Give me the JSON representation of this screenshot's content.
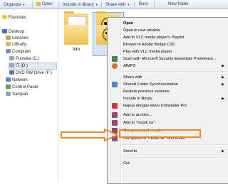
{
  "toolbar": {
    "organize": "Organize",
    "open": "Open",
    "include_in_library": "Include in library",
    "share_with": "Share with",
    "burn": "Burn",
    "new_folder": "New folder"
  },
  "nav": {
    "favorites": "Favorites",
    "desktop": "Desktop",
    "libraries": "Libraries",
    "user": "LiBrafly",
    "computer": "Computer",
    "drive_c": "Pustaka (C:)",
    "drive_d": "IT (D:)",
    "drive_e": "DVD RW Drive (F:)",
    "network": "Network",
    "control_panel": "Control Panel",
    "recycle": "Sampah"
  },
  "files": {
    "folder1_label": "foto",
    "folder2_label": "F"
  },
  "context_menu": {
    "open": "Open",
    "open_new_window": "Open in new window",
    "add_vlc_playlist": "Add to VLC media player's Playlist",
    "browse_bridge": "Browse in Adobe Bridge CS5",
    "play_vlc": "Play with VLC media player",
    "scan_mse": "Scan with Microsoft Security Essentials Prerelease...",
    "aimp": "AIMP3",
    "share_with": "Share with",
    "shared_folder_sync": "Shared Folder Synchronization",
    "restore_versions": "Restore previous versions",
    "include_library": "Include in library",
    "revo_uninstaller": "Hapus dengan Revo Uninstaller Pro",
    "add_archive": "Add to archive...",
    "add_musik_rar": "Add to \"musik.rar\"",
    "compress_email": "Compress and email...",
    "compress_musik_email": "Compress to \"musik.rar\" and email",
    "send_to": "Send to",
    "cut": "Cut"
  },
  "colors": {
    "highlight_box": "#f08a1c",
    "arrow": "#f08a1c",
    "selection": "#d5e4f7"
  }
}
